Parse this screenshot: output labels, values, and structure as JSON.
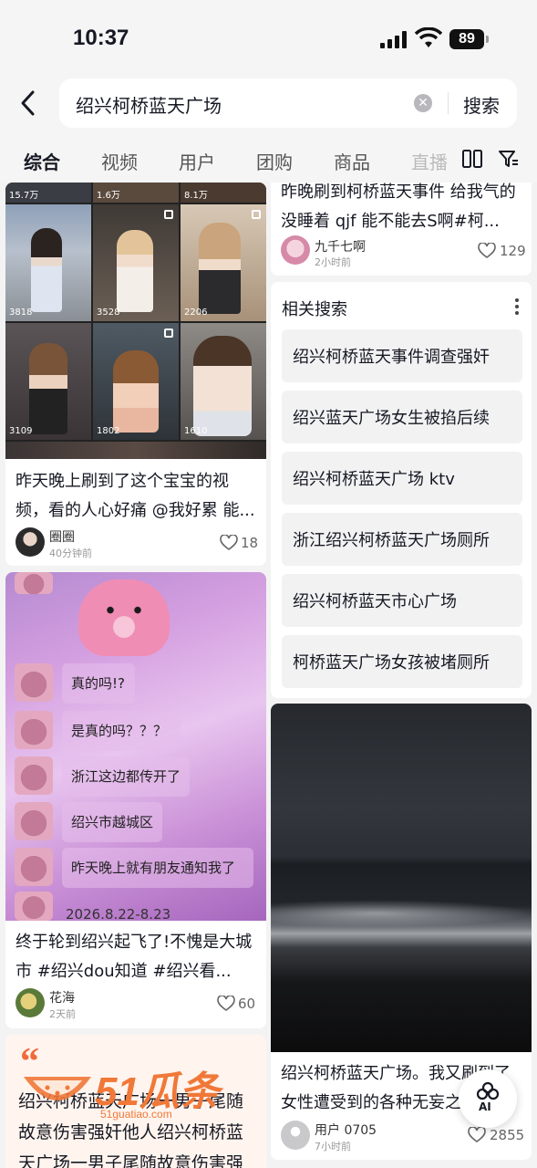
{
  "status_bar": {
    "time": "10:37",
    "battery": "89"
  },
  "search": {
    "query": "绍兴柯桥蓝天广场",
    "button": "搜索"
  },
  "tabs": [
    "综合",
    "视频",
    "用户",
    "团购",
    "商品",
    "直播"
  ],
  "left_column": {
    "card1": {
      "grid_counts_top": [
        "15.7万",
        "1.6万",
        "8.1万"
      ],
      "grid_counts": [
        "3818",
        "3528",
        "2206",
        "3109",
        "1802",
        "1610"
      ],
      "title": "昨天晚上刷到了这个宝宝的视频，看的人心好痛 @我好累 能...",
      "author": "圈圈",
      "time_ago": "40分钟前",
      "likes": "18"
    },
    "card2": {
      "chat_lines": [
        "真的吗!?",
        "是真的吗？？？",
        "浙江这边都传开了",
        "绍兴市越城区",
        "昨天晚上就有朋友通知我了",
        "2026.8.22-8.23"
      ],
      "title": "终于轮到绍兴起飞了!不愧是大城市 #绍兴dou知道 #绍兴看...",
      "author": "花海",
      "time_ago": "2天前",
      "likes": "60"
    },
    "card3": {
      "quote_mark": "“",
      "text_line1": "绍兴柯桥蓝天广场一男子尾随",
      "text_line2": "故意伤害强奸他人绍兴柯桥蓝",
      "text_line3": "天广场一男子尾随故意伤害强"
    }
  },
  "right_column": {
    "card1": {
      "title": "昨晚刷到柯桥蓝天事件 给我气的没睡着 qjf 能不能去S啊#柯...",
      "author": "九千七啊",
      "time_ago": "2小时前",
      "likes": "129"
    },
    "related": {
      "title": "相关搜索",
      "items": [
        "绍兴柯桥蓝天事件调查强奸",
        "绍兴蓝天广场女生被掐后续",
        "绍兴柯桥蓝天广场 ktv",
        "浙江绍兴柯桥蓝天广场厕所",
        "绍兴柯桥蓝天市心广场",
        "柯桥蓝天广场女孩被堵厕所"
      ]
    },
    "card2": {
      "title": "绍兴柯桥蓝天广场。我又刷到了女性遭受到的各种无妄之灾",
      "author": "用户 0705",
      "time_ago": "7小时前",
      "likes": "2855"
    }
  },
  "ai_button": "AI",
  "watermark": {
    "brand": "51瓜条",
    "site": "51guatiao.com"
  },
  "colors": {
    "accent": "#fe2c55",
    "watermark": "#f07838"
  }
}
